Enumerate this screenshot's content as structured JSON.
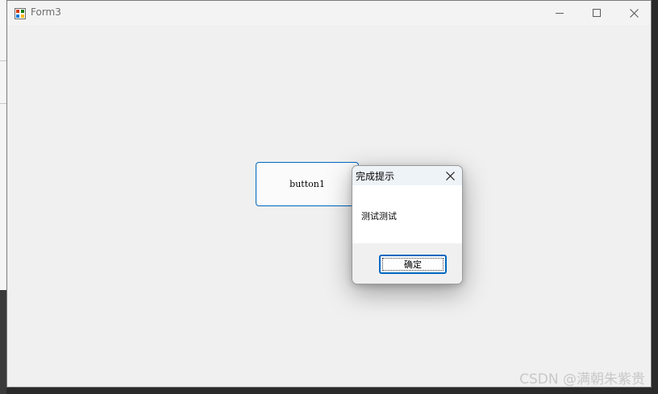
{
  "window": {
    "title": "Form3",
    "controls": {
      "minimize": "minimize-icon",
      "maximize": "maximize-icon",
      "close": "close-icon"
    }
  },
  "main": {
    "button1_label": "button1"
  },
  "dialog": {
    "title": "完成提示",
    "message": "测试测试",
    "ok_label": "确定",
    "close_icon": "close-icon"
  },
  "watermark": "CSDN @满朝朱紫贵",
  "colors": {
    "accent": "#0067c0",
    "titlebar": "#f3f3f3",
    "client": "#f0f0f0"
  }
}
